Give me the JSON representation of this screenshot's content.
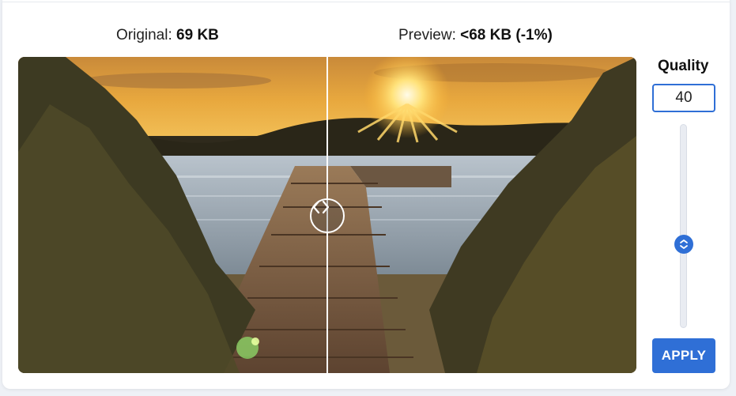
{
  "labels": {
    "original_prefix": "Original:",
    "original_size": "69 KB",
    "preview_prefix": "Preview:",
    "preview_size": "<68 KB (-1%)"
  },
  "quality": {
    "title": "Quality",
    "value": "40",
    "slider_level": 0.4
  },
  "apply_label": "APPLY",
  "colors": {
    "accent": "#2f6fd6",
    "card_bg": "#ffffff",
    "page_bg": "#eef1f6"
  },
  "icons": {
    "compare_handle": "chevron-left-right-icon",
    "slider_thumb": "chevron-up-down-icon"
  }
}
